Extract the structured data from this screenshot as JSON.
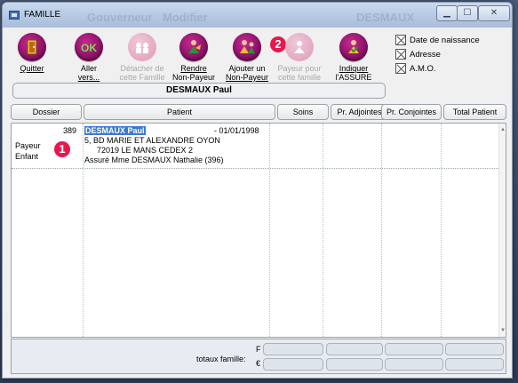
{
  "window": {
    "title": "FAMILLE",
    "ghost_texts": [
      "Gouverneur",
      "Modifier",
      "DESMAUX"
    ]
  },
  "toolbar": {
    "quitter": "Quitter",
    "aller_vers_1": "Aller",
    "aller_vers_2": "vers...",
    "detacher_1": "Détacher de",
    "detacher_2": "cette Famille",
    "rendre_1": "Rendre",
    "rendre_2": "Non-Payeur",
    "ajouter_1": "Ajouter un",
    "ajouter_2": "Non-Payeur",
    "payeur_1": "Payeur pour",
    "payeur_2": "cette famille",
    "indiquer_1": "Indiquer",
    "indiquer_2": "l'ASSURE",
    "badge_two": "2"
  },
  "options": {
    "date_naissance": "Date de naissance",
    "adresse": "Adresse",
    "amo": "A.M.O."
  },
  "family_name": "DESMAUX Paul",
  "columns": [
    "Dossier",
    "Patient",
    "Soins",
    "Pr. Adjointes",
    "Pr. Conjointes",
    "Total Patient"
  ],
  "row": {
    "dossier_number": "389",
    "role_1": "Payeur",
    "role_2": "Enfant",
    "badge_one": "1",
    "patient_name": "DESMAUX Paul",
    "birth_date": "- 01/01/1998",
    "address_1": "5, BD MARIE ET ALEXANDRE OYON",
    "address_2": "72019  LE MANS CEDEX 2",
    "insured": "Assuré Mme DESMAUX Nathalie (396)"
  },
  "footer": {
    "totals_label": "totaux famille:",
    "currency_f": "F",
    "currency_e": "€"
  },
  "colors": {
    "accent_magenta": "#8b1066",
    "badge_red": "#e8174f",
    "selection_blue": "#3b78d4"
  }
}
